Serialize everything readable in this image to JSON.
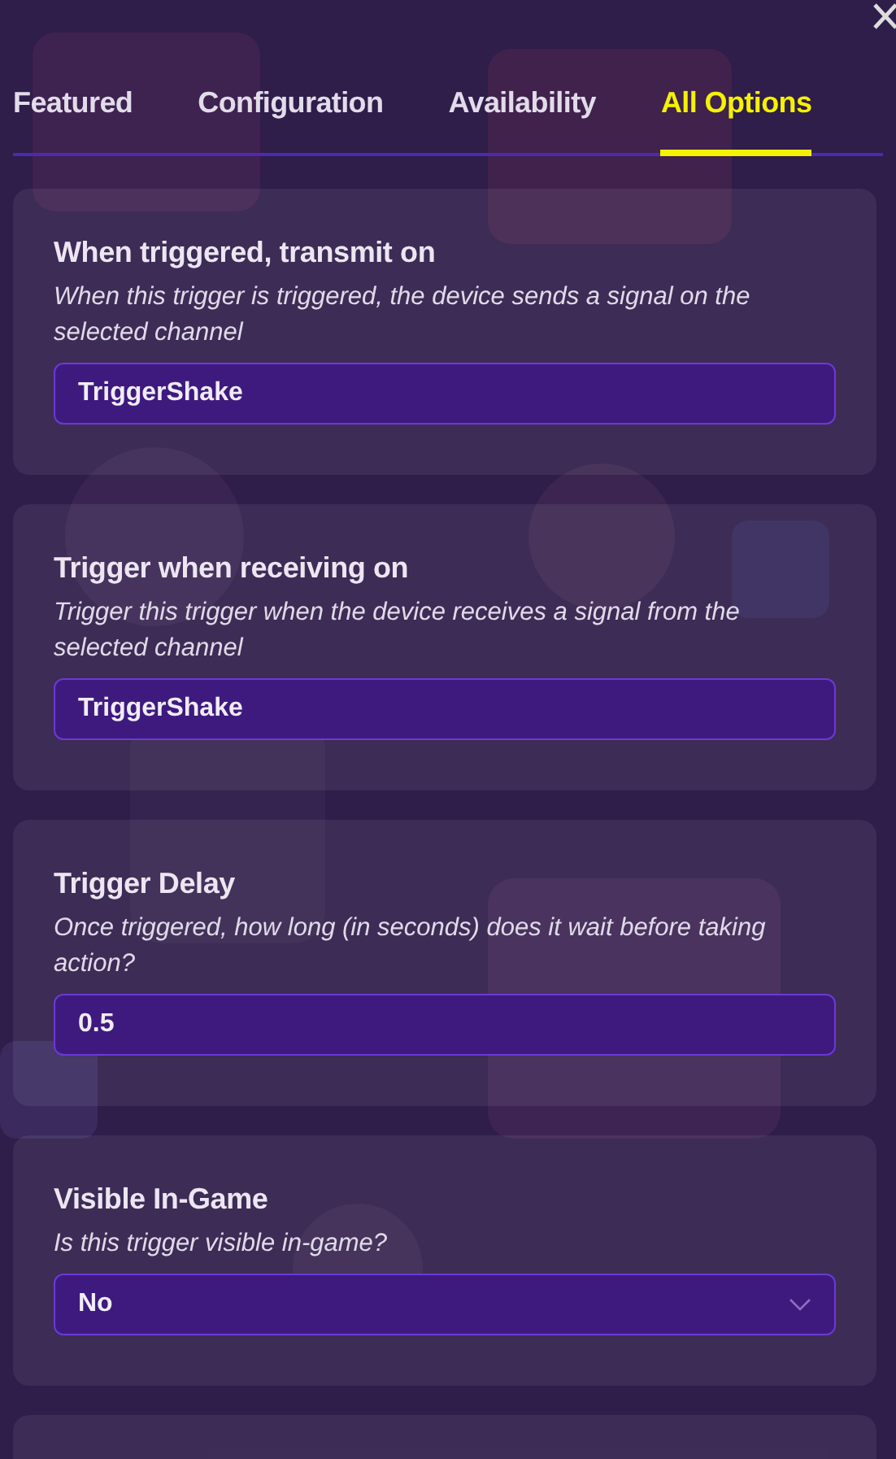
{
  "tabs": [
    {
      "label": "Featured",
      "selected": false
    },
    {
      "label": "Configuration",
      "selected": false
    },
    {
      "label": "Availability",
      "selected": false
    },
    {
      "label": "All Options",
      "selected": true
    }
  ],
  "options": [
    {
      "kind": "text",
      "title": "When triggered, transmit on",
      "description": "When this trigger is triggered, the device sends a signal on the selected channel",
      "value": "TriggerShake"
    },
    {
      "kind": "text",
      "title": "Trigger when receiving on",
      "description": "Trigger this trigger when the device receives a signal from the selected channel",
      "value": "TriggerShake"
    },
    {
      "kind": "text",
      "title": "Trigger Delay",
      "description": "Once triggered, how long (in seconds) does it wait before taking action?",
      "value": "0.5"
    },
    {
      "kind": "select",
      "title": "Visible In-Game",
      "description": "Is this trigger visible in-game?",
      "value": "No"
    }
  ]
}
